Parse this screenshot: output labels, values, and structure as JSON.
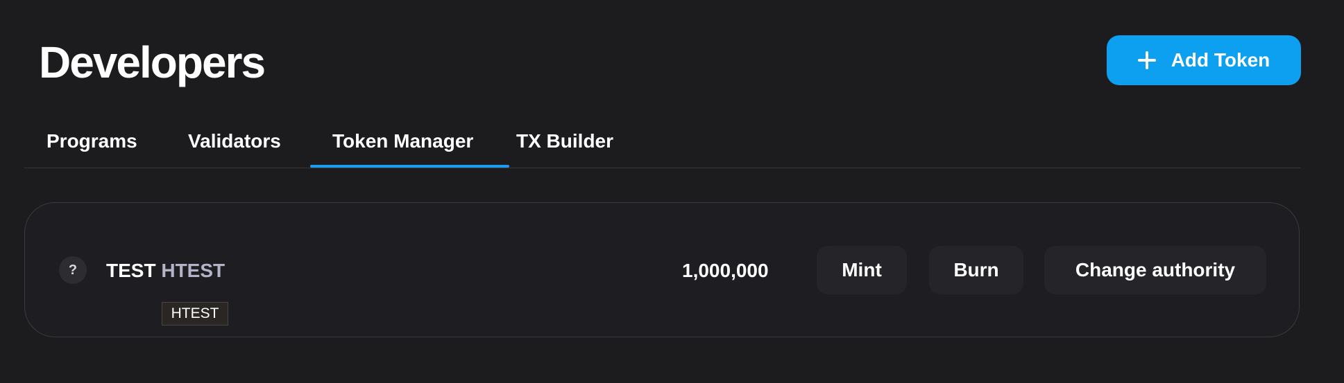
{
  "header": {
    "title": "Developers",
    "add_button_label": "Add Token"
  },
  "tabs": [
    {
      "label": "Programs",
      "active": false
    },
    {
      "label": "Validators",
      "active": false
    },
    {
      "label": "Token Manager",
      "active": true
    },
    {
      "label": "TX Builder",
      "active": false
    }
  ],
  "token": {
    "icon_glyph": "?",
    "name": "TEST",
    "symbol": "HTEST",
    "tooltip": "HTEST",
    "supply": "1,000,000",
    "actions": {
      "mint": "Mint",
      "burn": "Burn",
      "change_authority": "Change authority"
    }
  },
  "colors": {
    "background": "#1c1c1f",
    "accent": "#0ea0f0",
    "tab_indicator": "#1d9bf0",
    "symbol_text": "#b4b4c8"
  },
  "icons": {
    "add": "plus-icon",
    "token": "question-icon"
  }
}
